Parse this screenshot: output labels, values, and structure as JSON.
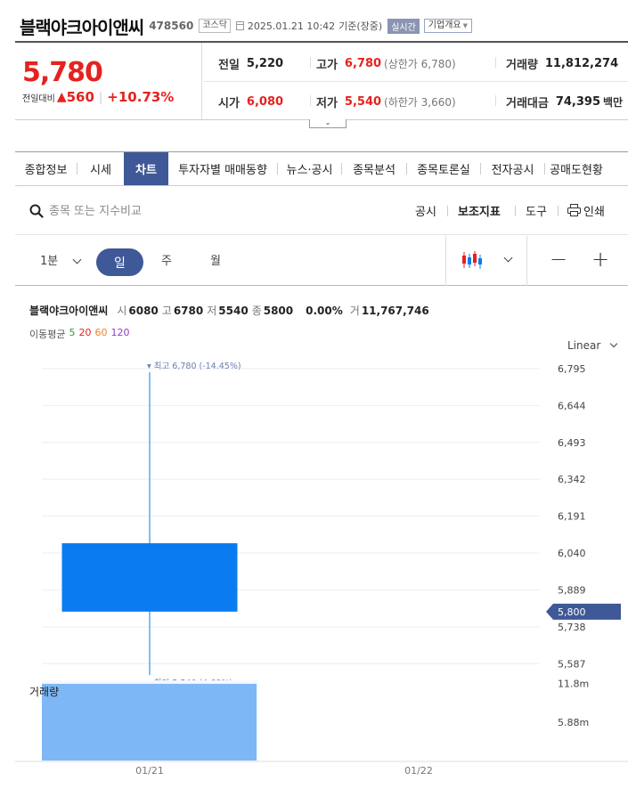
{
  "header": {
    "stock_name": "블랙야크아이앤씨",
    "stock_code": "478560",
    "market": "코스닥",
    "datetime": "2025.01.21 10:42",
    "basis": "기준(장중)",
    "realtime": "실시간",
    "company_button": "기업개요"
  },
  "price": {
    "current": "5,780",
    "change_label": "전일대비",
    "change_abs": "560",
    "change_pct": "+10.73%"
  },
  "stats": {
    "prev_close_label": "전일",
    "prev_close": "5,220",
    "high_label": "고가",
    "high": "6,780",
    "upper_limit": "(상한가 6,780)",
    "volume_label": "거래량",
    "volume": "11,812,274",
    "open_label": "시가",
    "open": "6,080",
    "low_label": "저가",
    "low": "5,540",
    "lower_limit": "(하한가 3,660)",
    "value_label": "거래대금",
    "value": "74,395",
    "value_unit": "백만"
  },
  "tabs": [
    "종합정보",
    "시세",
    "차트",
    "투자자별 매매동향",
    "뉴스·공시",
    "종목분석",
    "종목토론실",
    "전자공시",
    "공매도현황"
  ],
  "active_tab": "차트",
  "search": {
    "placeholder": "종목 또는 지수비교"
  },
  "tools": [
    "공시",
    "보조지표",
    "도구",
    "인쇄"
  ],
  "periods": {
    "minute": "1분",
    "day": "일",
    "week": "주",
    "month": "월"
  },
  "chart_info": {
    "name": "블랙야크아이앤씨",
    "open_label": "시",
    "open": "6080",
    "high_label": "고",
    "high": "6780",
    "low_label": "저",
    "low": "5540",
    "close_label": "종",
    "close": "5800",
    "change": "0.00%",
    "vol_label": "거",
    "volume": "11,767,746"
  },
  "moving_average": {
    "label": "이동평균",
    "items": [
      {
        "value": "5",
        "color": "#2aa32a"
      },
      {
        "value": "20",
        "color": "#e5221f"
      },
      {
        "value": "60",
        "color": "#e8862a"
      },
      {
        "value": "120",
        "color": "#8e3fc9"
      }
    ]
  },
  "scale_label": "Linear",
  "volume_label": "거래량",
  "colors": {
    "accent": "#3f5897",
    "up": "#e5221f",
    "candle": "#0a7cf0",
    "volume": "#7db7f5"
  },
  "chart_data": {
    "type": "candlestick",
    "dates": [
      "01/21",
      "01/22"
    ],
    "candles": [
      {
        "date": "01/21",
        "open": 6080,
        "high": 6780,
        "low": 5540,
        "close": 5800
      }
    ],
    "volume": [
      11767746
    ],
    "y_ticks": [
      6795,
      6644,
      6493,
      6342,
      6191,
      6040,
      5889,
      5738,
      5587
    ],
    "y_tick_labels": [
      "6,795",
      "6,644",
      "6,493",
      "6,342",
      "6,191",
      "6,040",
      "5,889",
      "5,738",
      "5,587"
    ],
    "ylim": [
      5515,
      6864
    ],
    "current_price_label": "5,800",
    "current_price": 5800,
    "high_annotation": "최고 6,780 (-14.45%)",
    "low_annotation": "최저 5,540 (4.69%)",
    "volume_ticks": [
      "11.8m",
      "5.88m"
    ],
    "volume_tick_values": [
      11800000,
      5880000
    ],
    "volume_max": 12300000
  }
}
